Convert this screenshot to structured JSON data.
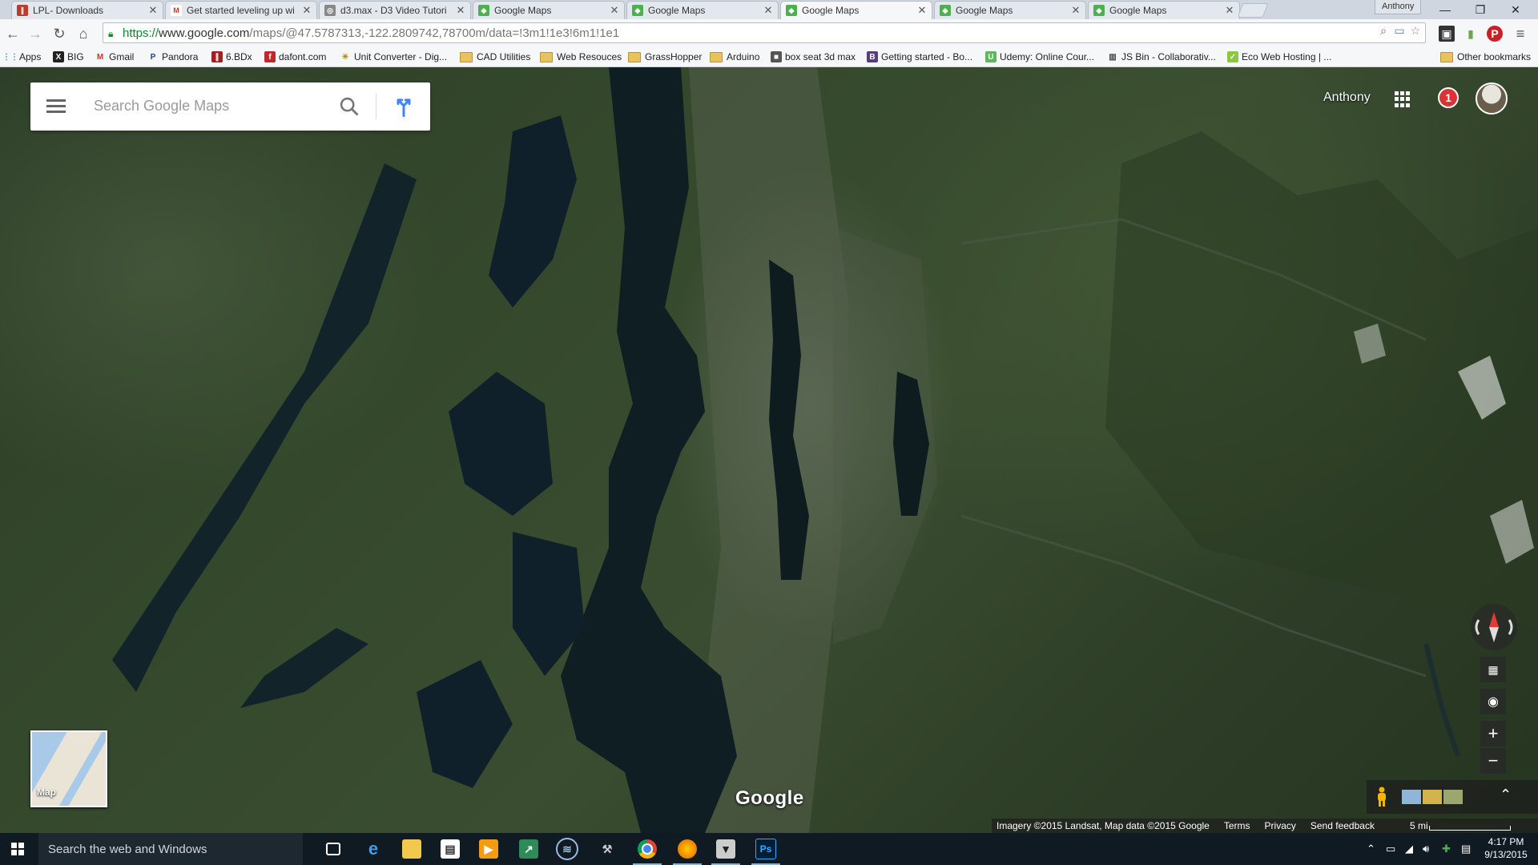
{
  "browser": {
    "tabs": [
      {
        "title": "LPL- Downloads",
        "favicon": "lpl-icon",
        "active": false
      },
      {
        "title": "Get started leveling up wi",
        "favicon": "gmail-icon",
        "active": false
      },
      {
        "title": "d3.max - D3 Video Tutori",
        "favicon": "d3max-icon",
        "active": false
      },
      {
        "title": "Google Maps",
        "favicon": "maps-icon",
        "active": false
      },
      {
        "title": "Google Maps",
        "favicon": "maps-icon",
        "active": false
      },
      {
        "title": "Google Maps",
        "favicon": "maps-icon",
        "active": true
      },
      {
        "title": "Google Maps",
        "favicon": "maps-icon",
        "active": false
      },
      {
        "title": "Google Maps",
        "favicon": "maps-icon",
        "active": false
      }
    ],
    "profile_name": "Anthony",
    "url_scheme": "https://",
    "url_host": "www.google.com",
    "url_path": "/maps/@47.5787313,-122.2809742,78700m/data=!3m1!1e3!6m1!1e1",
    "bookmarks": [
      {
        "label": "Apps",
        "icon": "apps-grid-icon"
      },
      {
        "label": "BIG",
        "icon": "big-icon"
      },
      {
        "label": "Gmail",
        "icon": "gmail-icon"
      },
      {
        "label": "Pandora",
        "icon": "pandora-icon"
      },
      {
        "label": "6.BDx",
        "icon": "bdx-icon"
      },
      {
        "label": "dafont.com",
        "icon": "dafont-icon"
      },
      {
        "label": "Unit Converter - Dig...",
        "icon": "unit-converter-icon"
      },
      {
        "label": "CAD Utilities",
        "icon": "folder-icon"
      },
      {
        "label": "Web Resouces",
        "icon": "folder-icon"
      },
      {
        "label": "GrassHopper",
        "icon": "folder-icon"
      },
      {
        "label": "Arduino",
        "icon": "folder-icon"
      },
      {
        "label": "box seat 3d max",
        "icon": "box-seat-icon"
      },
      {
        "label": "Getting started - Bo...",
        "icon": "bootstrap-icon"
      },
      {
        "label": "Udemy: Online Cour...",
        "icon": "udemy-icon"
      },
      {
        "label": "JS Bin - Collaborativ...",
        "icon": "jsbin-icon"
      },
      {
        "label": "Eco Web Hosting | ...",
        "icon": "eco-hosting-icon"
      }
    ],
    "other_bookmarks": "Other bookmarks"
  },
  "maps": {
    "search_placeholder": "Search Google Maps",
    "user_name": "Anthony",
    "notification_count": "1",
    "minimap_label": "Map",
    "logo": "Google",
    "footer": {
      "attribution": "Imagery ©2015 Landsat, Map data ©2015 Google",
      "terms": "Terms",
      "privacy": "Privacy",
      "send_feedback": "Send feedback",
      "scale": "5 mi"
    }
  },
  "taskbar": {
    "search_placeholder": "Search the web and Windows",
    "time": "4:17 PM",
    "date": "9/13/2015"
  },
  "colors": {
    "water": "#0f1e22",
    "land": "#34482c",
    "notification": "#db3236",
    "taskbar": "#101a22"
  }
}
